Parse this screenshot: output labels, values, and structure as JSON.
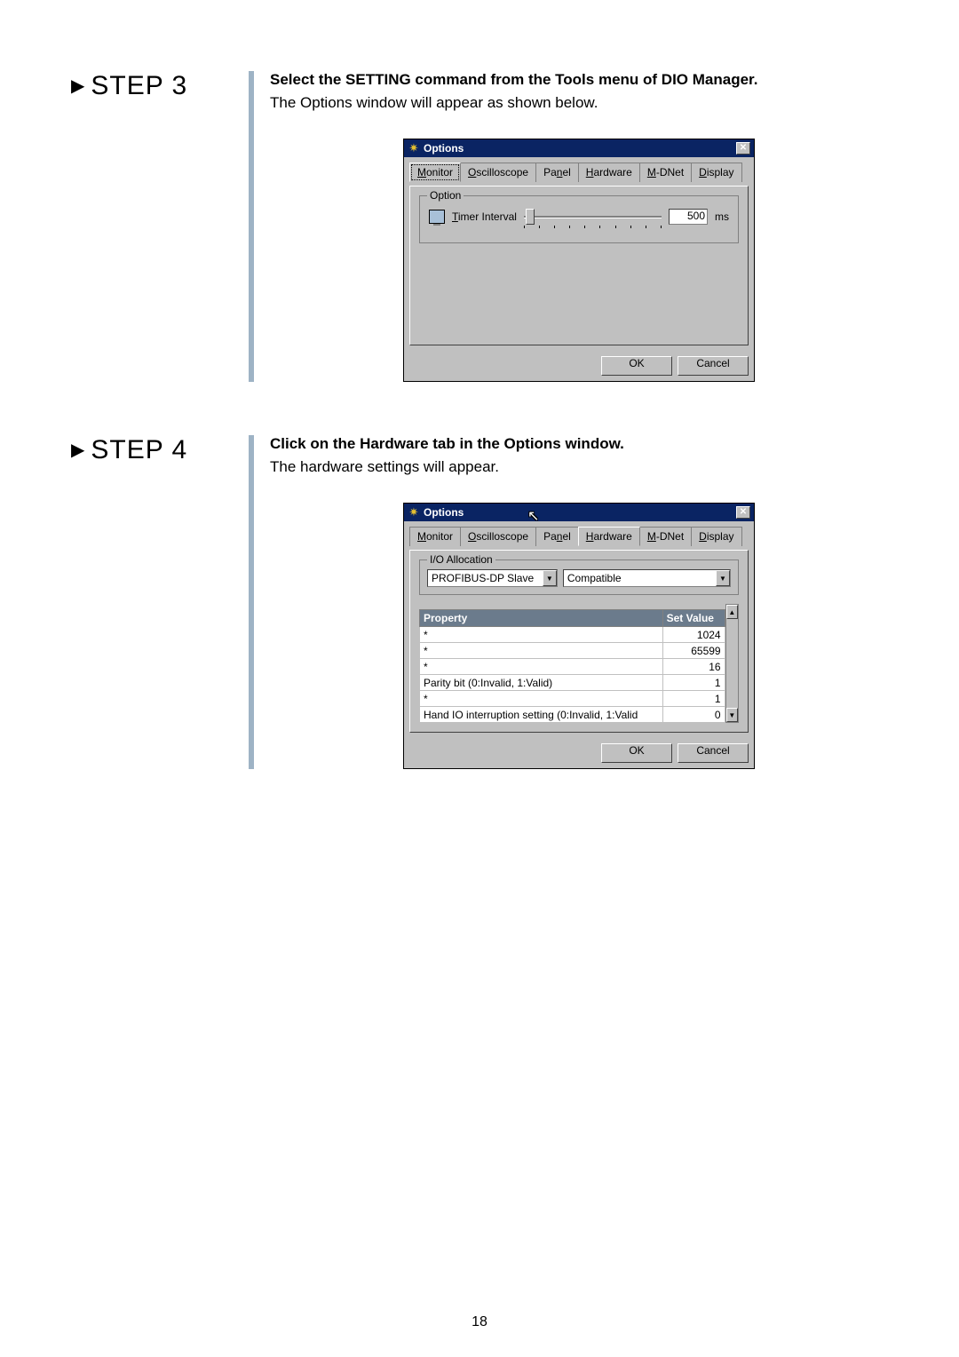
{
  "page_number": "18",
  "step3": {
    "title": "STEP 3",
    "desc_bold": "Select the SETTING command from the Tools menu of DIO Manager.",
    "desc_text": "The Options window will appear as shown below.",
    "dialog": {
      "title": "Options",
      "tabs": [
        "Monitor",
        "Oscilloscope",
        "Panel",
        "Hardware",
        "M-DNet",
        "Display"
      ],
      "active_tab": 0,
      "fieldset": "Option",
      "timer_label": "Timer Interval",
      "timer_value": "500",
      "timer_unit": "ms",
      "ok": "OK",
      "cancel": "Cancel"
    }
  },
  "step4": {
    "title": "STEP 4",
    "desc_bold": "Click on the Hardware tab in the Options window.",
    "desc_text": "The hardware settings will appear.",
    "dialog": {
      "title": "Options",
      "tabs": [
        "Monitor",
        "Oscilloscope",
        "Panel",
        "Hardware",
        "M-DNet",
        "Display"
      ],
      "active_tab": 3,
      "io_fieldset": "I/O Allocation",
      "combo1": "PROFIBUS-DP Slave",
      "combo2": "Compatible",
      "col_property": "Property",
      "col_setvalue": "Set Value",
      "rows": [
        {
          "prop": "*",
          "val": "1024"
        },
        {
          "prop": "*",
          "val": "65599"
        },
        {
          "prop": "*",
          "val": "16"
        },
        {
          "prop": "Parity bit (0:Invalid, 1:Valid)",
          "val": "1"
        },
        {
          "prop": "*",
          "val": "1"
        },
        {
          "prop": "Hand IO  interruption setting (0:Invalid, 1:Valid",
          "val": "0"
        }
      ],
      "ok": "OK",
      "cancel": "Cancel"
    }
  }
}
